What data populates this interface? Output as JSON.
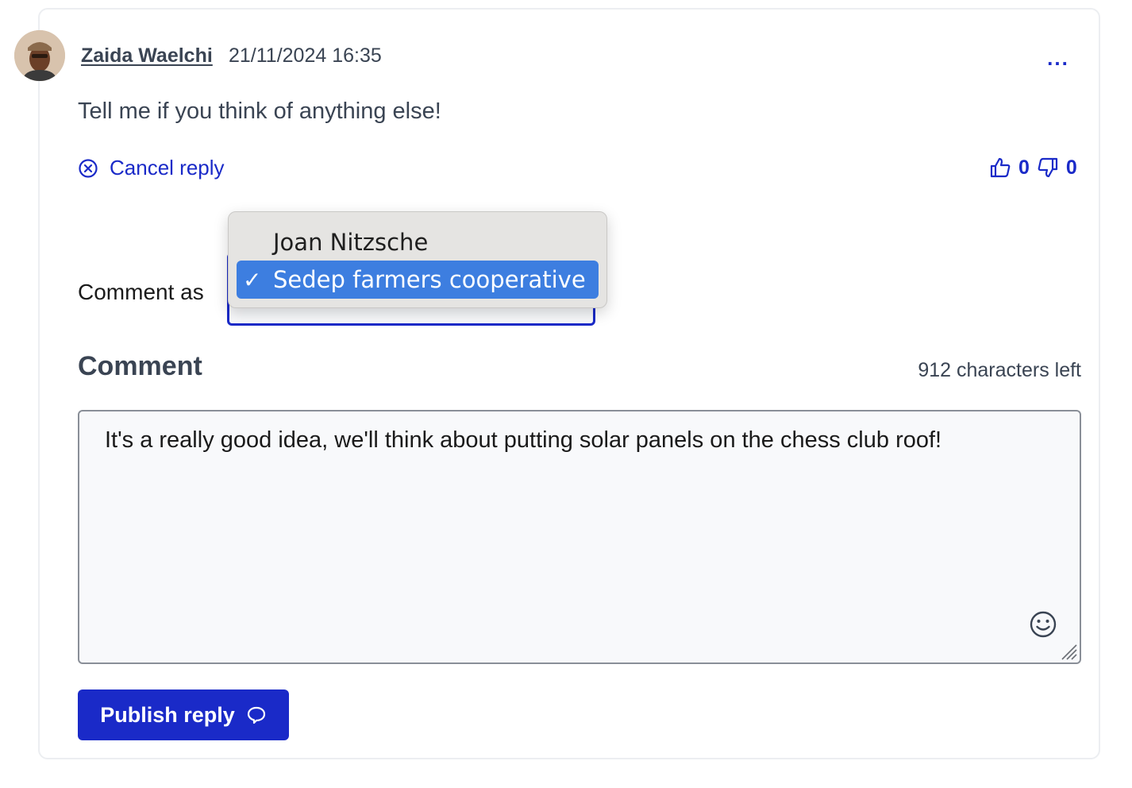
{
  "comment": {
    "author": "Zaida Waelchi",
    "timestamp": "21/11/2024 16:35",
    "more_label": "...",
    "text": "Tell me if you think of anything else!",
    "upvotes": "0",
    "downvotes": "0"
  },
  "reply": {
    "cancel_label": "Cancel reply",
    "comment_as_label": "Comment as",
    "comment_as_options": [
      "Joan Nitzsche",
      "Sedep farmers cooperative"
    ],
    "comment_as_selected": "Sedep farmers cooperative",
    "checkmark": "✓",
    "comment_heading": "Comment",
    "chars_left": "912 characters left",
    "comment_value": "It's a really good idea, we'll think about putting solar panels on the chess club roof!",
    "publish_label": "Publish reply"
  },
  "colors": {
    "accent": "#1a2ac8",
    "selected_option": "#3d7ee0",
    "text": "#3a4453"
  },
  "icons": {
    "avatar": "user-avatar-photo",
    "cancel": "circle-x-icon",
    "upvote": "thumbs-up-icon",
    "downvote": "thumbs-down-icon",
    "emoji": "smiley-icon",
    "publish": "speech-bubble-icon",
    "more": "ellipsis-icon"
  }
}
